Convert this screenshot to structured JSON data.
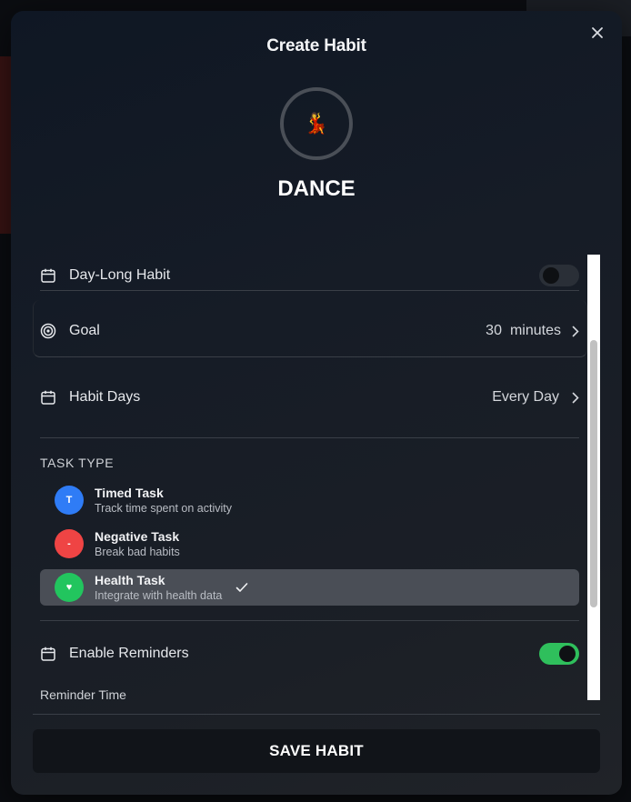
{
  "modal": {
    "title": "Create Habit",
    "close_icon": "close-icon",
    "habit_emoji": "💃",
    "habit_name": "DANCE"
  },
  "settings": {
    "day_long": {
      "label": "Day-Long Habit",
      "enabled": false,
      "icon": "calendar-icon"
    },
    "goal": {
      "label": "Goal",
      "value": "30",
      "unit": "minutes",
      "icon": "target-icon"
    },
    "habit_days": {
      "label": "Habit Days",
      "value": "Every Day",
      "icon": "calendar-icon"
    }
  },
  "task_type": {
    "section_title": "TASK TYPE",
    "options": [
      {
        "badge": "T",
        "title": "Timed Task",
        "subtitle": "Track time spent on activity",
        "color": "#2f7cf6",
        "selected": false
      },
      {
        "badge": "-",
        "title": "Negative Task",
        "subtitle": "Break bad habits",
        "color": "#ef4444",
        "selected": false
      },
      {
        "badge": "♥",
        "title": "Health Task",
        "subtitle": "Integrate with health data",
        "color": "#22c55e",
        "selected": true
      }
    ]
  },
  "reminders": {
    "label": "Enable Reminders",
    "enabled": true,
    "time_label": "Reminder Time"
  },
  "save_button": {
    "label": "SAVE HABIT"
  },
  "colors": {
    "accent_green": "#2fbf5c",
    "modal_bg": "#161c26"
  }
}
